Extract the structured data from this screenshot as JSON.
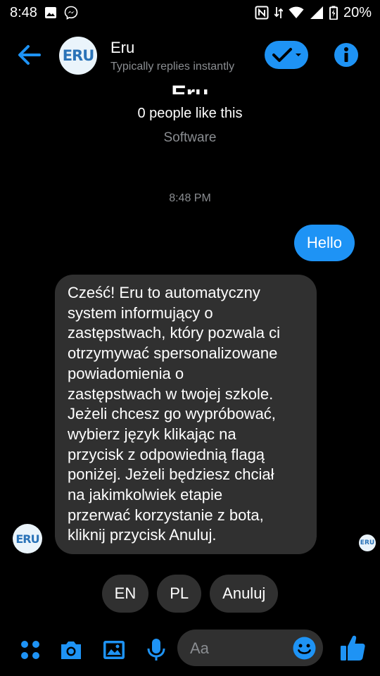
{
  "status_bar": {
    "time": "8:48",
    "battery": "20%"
  },
  "header": {
    "name": "Eru",
    "subtitle": "Typically replies instantly",
    "avatar_text": "ERU"
  },
  "page_info": {
    "name": "Eru",
    "likes": "0 people like this",
    "category": "Software"
  },
  "conversation": {
    "timestamp": "8:48 PM",
    "messages": [
      {
        "from": "user",
        "text": "Hello"
      },
      {
        "from": "bot",
        "text": "Cześć! Eru to automatyczny\nsystem informujący o\nzastępstwach, który pozwala ci\notrzymywać spersonalizowane\npowiadomienia o\nzastępstwach w twojej szkole.\nJeżeli chcesz go wypróbować,\nwybierz język klikając na\nprzycisk z odpowiednią flagą\nponiżej. Jeżeli będziesz chciał\nna jakimkolwiek etapie\nprzerwać korzystanie z bota,\nkliknij przycisk Anuluj."
      }
    ],
    "quick_replies": [
      "EN",
      "PL",
      "Anuluj"
    ]
  },
  "composer": {
    "placeholder": "Aa"
  },
  "colors": {
    "accent": "#1e93f5",
    "background": "#000000",
    "bubble_incoming": "#303030",
    "muted_text": "#8a8d91"
  },
  "icons": [
    "back-arrow-icon",
    "checkmark-icon",
    "info-icon",
    "menu-dots-icon",
    "camera-icon",
    "image-icon",
    "microphone-icon",
    "emoji-icon",
    "thumbs-up-icon"
  ]
}
